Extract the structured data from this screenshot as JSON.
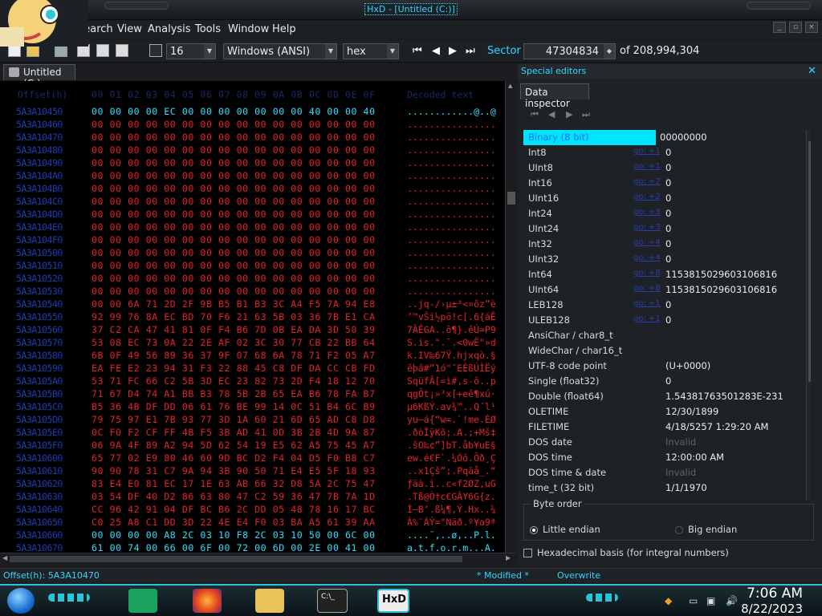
{
  "window": {
    "title": "HxD - [Untitled (C:)]"
  },
  "menu": [
    "Search",
    "View",
    "Analysis",
    "Tools",
    "Window",
    "Help"
  ],
  "toolbar": {
    "bytes_per_row": "16",
    "charset": "Windows (ANSI)",
    "display_mode": "hex",
    "sector_label": "Sector",
    "sector_value": "47304834",
    "sector_total": "of 208,994,304"
  },
  "doc_tab": "Untitled (C:)",
  "hex_header": {
    "offset": "Offset(h)",
    "columns": [
      "00",
      "01",
      "02",
      "03",
      "04",
      "05",
      "06",
      "07",
      "08",
      "09",
      "0A",
      "0B",
      "0C",
      "0D",
      "0E",
      "0F"
    ],
    "text": "Decoded text"
  },
  "rows": [
    {
      "offset": "5A3A10450",
      "bytes": "00 00 00 00 EC 00 00 00 00 00 00 00 40 00 00 40",
      "ascii": "............@..@",
      "cyan": true
    },
    {
      "offset": "5A3A10460",
      "bytes": "00 00 00 00 00 00 00 00 00 00 00 00 00 00 00 00",
      "ascii": "................"
    },
    {
      "offset": "5A3A10470",
      "bytes": "00 00 00 00 00 00 00 00 00 00 00 00 00 00 00 00",
      "ascii": "................"
    },
    {
      "offset": "5A3A10480",
      "bytes": "00 00 00 00 00 00 00 00 00 00 00 00 00 00 00 00",
      "ascii": "................"
    },
    {
      "offset": "5A3A10490",
      "bytes": "00 00 00 00 00 00 00 00 00 00 00 00 00 00 00 00",
      "ascii": "................"
    },
    {
      "offset": "5A3A104A0",
      "bytes": "00 00 00 00 00 00 00 00 00 00 00 00 00 00 00 00",
      "ascii": "................"
    },
    {
      "offset": "5A3A104B0",
      "bytes": "00 00 00 00 00 00 00 00 00 00 00 00 00 00 00 00",
      "ascii": "................"
    },
    {
      "offset": "5A3A104C0",
      "bytes": "00 00 00 00 00 00 00 00 00 00 00 00 00 00 00 00",
      "ascii": "................"
    },
    {
      "offset": "5A3A104D0",
      "bytes": "00 00 00 00 00 00 00 00 00 00 00 00 00 00 00 00",
      "ascii": "................"
    },
    {
      "offset": "5A3A104E0",
      "bytes": "00 00 00 00 00 00 00 00 00 00 00 00 00 00 00 00",
      "ascii": "................"
    },
    {
      "offset": "5A3A104F0",
      "bytes": "00 00 00 00 00 00 00 00 00 00 00 00 00 00 00 00",
      "ascii": "................"
    },
    {
      "offset": "5A3A10500",
      "bytes": "00 00 00 00 00 00 00 00 00 00 00 00 00 00 00 00",
      "ascii": "................"
    },
    {
      "offset": "5A3A10510",
      "bytes": "00 00 00 00 00 00 00 00 00 00 00 00 00 00 00 00",
      "ascii": "................"
    },
    {
      "offset": "5A3A10520",
      "bytes": "00 00 00 00 00 00 00 00 00 00 00 00 00 00 00 00",
      "ascii": "................"
    },
    {
      "offset": "5A3A10530",
      "bytes": "00 00 00 00 00 00 00 00 00 00 00 00 00 00 00 00",
      "ascii": "................"
    },
    {
      "offset": "5A3A10540",
      "bytes": "00 00 6A 71 2D 2F 9B B5 B1 B3 3C A4 F5 7A 94 E8",
      "ascii": "..jq-/›µ±³<¤õz”è"
    },
    {
      "offset": "5A3A10550",
      "bytes": "92 99 76 8A EC BD 70 F6 21 63 5B 03 36 7B E1 CA",
      "ascii": "’™vŠì½pö!c[.6{áÊ"
    },
    {
      "offset": "5A3A10560",
      "bytes": "37 C2 CA 47 41 81 0F F4 B6 7D 0B EA DA 3D 50 39",
      "ascii": "7ÂÊGA..ô¶}.êÚ=P9"
    },
    {
      "offset": "5A3A10570",
      "bytes": "53 08 EC 73 0A 22 2E AF 02 3C 30 77 CB 22 BB 64",
      "ascii": "S.ìs.\".¯.<0wË\"»d"
    },
    {
      "offset": "5A3A10580",
      "bytes": "6B 0F 49 56 89 36 37 9F 07 68 6A 78 71 F2 05 A7",
      "ascii": "k.IV‰67Ÿ.hjxqò.§"
    },
    {
      "offset": "5A3A10590",
      "bytes": "EA FE E2 23 94 31 F3 22 88 45 C8 DF DA CC CB FD",
      "ascii": "êþâ#”1ó\"ˆEÈßÚÌËý"
    },
    {
      "offset": "5A3A105A0",
      "bytes": "53 71 FC 66 C2 5B 3D EC 23 82 73 2D F4 18 12 70",
      "ascii": "SqüfÂ[=ì#‚s-ô..p"
    },
    {
      "offset": "5A3A105B0",
      "bytes": "71 67 D4 74 A1 BB B3 78 5B 2B 65 EA B6 78 FA B7",
      "ascii": "qgÔt¡»³x[+eê¶xú·"
    },
    {
      "offset": "5A3A105C0",
      "bytes": "B5 36 4B DF DD 06 61 76 BE 99 14 0C 51 B4 6C B9",
      "ascii": "µ6KßÝ.av¾™..Q´l¹"
    },
    {
      "offset": "5A3A105D0",
      "bytes": "79 75 97 E1 7B 93 77 3D 1A 60 21 6D 65 AD C8 D8",
      "ascii": "yu—á{“w=.`!me.ÈØ"
    },
    {
      "offset": "5A3A105E0",
      "bytes": "0C F0 F2 CF FF 4B F5 3B AD 41 0D 3B 2B 4D 9A 87",
      "ascii": ".ðòÏÿKõ;.A.;+Mš‡"
    },
    {
      "offset": "5A3A105F0",
      "bytes": "06 9A 4F 89 A2 94 5D 62 54 19 E5 62 A5 75 45 A7",
      "ascii": ".šO‰¢”]bT.åb¥uE§"
    },
    {
      "offset": "5A3A10600",
      "bytes": "65 77 02 E9 80 46 60 9D BC D2 F4 04 D5 F0 B8 C7",
      "ascii": "ew.é€F`.¼Òô.Õð¸Ç"
    },
    {
      "offset": "5A3A10610",
      "bytes": "90 90 78 31 C7 9A 94 3B 90 50 71 E4 E5 5F 18 93",
      "ascii": "..x1Çš”;.Pqäå_.“"
    },
    {
      "offset": "5A3A10620",
      "bytes": "83 E4 E0 81 EC 17 1E 63 AB 66 32 D8 5A 2C 75 47",
      "ascii": "ƒäà.ì..c«f2ØZ,uG"
    },
    {
      "offset": "5A3A10630",
      "bytes": "03 54 DF 40 D2 86 63 80 47 C2 59 36 47 7B 7A 1D",
      "ascii": ".Tß@Ò†c€GÂY6G{z."
    },
    {
      "offset": "5A3A10640",
      "bytes": "CC 96 42 91 04 DF BC B6 2C DD 05 48 78 16 17 BC",
      "ascii": "Ì–B‘.ß¼¶,Ý.Hx..¼"
    },
    {
      "offset": "5A3A10650",
      "bytes": "C0 25 A8 C1 DD 3D 22 4E E4 F0 03 BA A5 61 39 AA",
      "ascii": "À%¨ÁÝ=\"Näð.º¥a9ª"
    },
    {
      "offset": "5A3A10660",
      "bytes": "00 00 00 00 A8 2C 03 10 F8 2C 03 10 50 00 6C 00",
      "ascii": "....¨,..ø,..P.l.",
      "cyan": true
    },
    {
      "offset": "5A3A10670",
      "bytes": "61 00 74 00 66 00 6F 00 72 00 6D 00 2E 00 41 00",
      "ascii": "a.t.f.o.r.m...A.",
      "cyan": true
    }
  ],
  "status": {
    "offset": "Offset(h): 5A3A10470",
    "modified": "* Modified *",
    "mode": "Overwrite"
  },
  "panel": {
    "title": "Special editors",
    "tab": "Data inspector"
  },
  "inspector": [
    {
      "name": "Binary (8 bit)",
      "value": "00000000",
      "selected": true
    },
    {
      "name": "Int8",
      "link": "go: +1",
      "value": "0"
    },
    {
      "name": "UInt8",
      "link": "go: +1",
      "value": "0"
    },
    {
      "name": "Int16",
      "link": "go: +2",
      "value": "0"
    },
    {
      "name": "UInt16",
      "link": "go: +2",
      "value": "0"
    },
    {
      "name": "Int24",
      "link": "go: +3",
      "value": "0"
    },
    {
      "name": "UInt24",
      "link": "go: +3",
      "value": "0"
    },
    {
      "name": "Int32",
      "link": "go: +4",
      "value": "0"
    },
    {
      "name": "UInt32",
      "link": "go: +4",
      "value": "0"
    },
    {
      "name": "Int64",
      "link": "go: +8",
      "value": "1153815029603106816"
    },
    {
      "name": "UInt64",
      "link": "go: +8",
      "value": "1153815029603106816"
    },
    {
      "name": "LEB128",
      "link": "go: +1",
      "value": "0"
    },
    {
      "name": "ULEB128",
      "link": "go: +1",
      "value": "0"
    },
    {
      "name": "AnsiChar / char8_t",
      "value": ""
    },
    {
      "name": "WideChar / char16_t",
      "value": ""
    },
    {
      "name": "UTF-8 code point",
      "value": "(U+0000)"
    },
    {
      "name": "Single (float32)",
      "value": "0"
    },
    {
      "name": "Double (float64)",
      "value": "1.54381763501283E-231"
    },
    {
      "name": "OLETIME",
      "value": "12/30/1899"
    },
    {
      "name": "FILETIME",
      "value": "4/18/5257 1:29:20 AM"
    },
    {
      "name": "DOS date",
      "value": "Invalid",
      "dim": true
    },
    {
      "name": "DOS time",
      "value": "12:00:00 AM"
    },
    {
      "name": "DOS time & date",
      "value": "Invalid",
      "dim": true
    },
    {
      "name": "time_t (32 bit)",
      "value": "1/1/1970"
    }
  ],
  "byte_order": {
    "label": "Byte order",
    "little": "Little endian",
    "big": "Big endian"
  },
  "hex_basis": "Hexadecimal basis (for integral numbers)",
  "clock": {
    "time": "7:06 AM",
    "date": "8/22/2023"
  }
}
